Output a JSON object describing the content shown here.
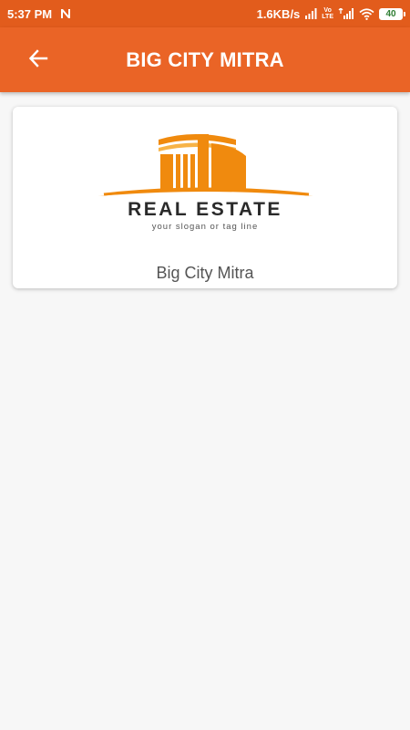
{
  "status_bar": {
    "time": "5:37 PM",
    "network_speed": "1.6KB/s",
    "volte_top": "Vo",
    "volte_bottom": "LTE",
    "battery_level": "40",
    "battery_color": "#2e7d32"
  },
  "app_bar": {
    "title": "BIG CITY MITRA",
    "back_icon": "arrow-left-icon",
    "background": "#ea6426"
  },
  "card": {
    "logo_title": "REAL ESTATE",
    "logo_slogan": "your slogan or tag line",
    "label": "Big City Mitra",
    "logo_colors": {
      "primary": "#f08a0e",
      "light": "#f7b347",
      "text": "#2a2a2a"
    }
  }
}
